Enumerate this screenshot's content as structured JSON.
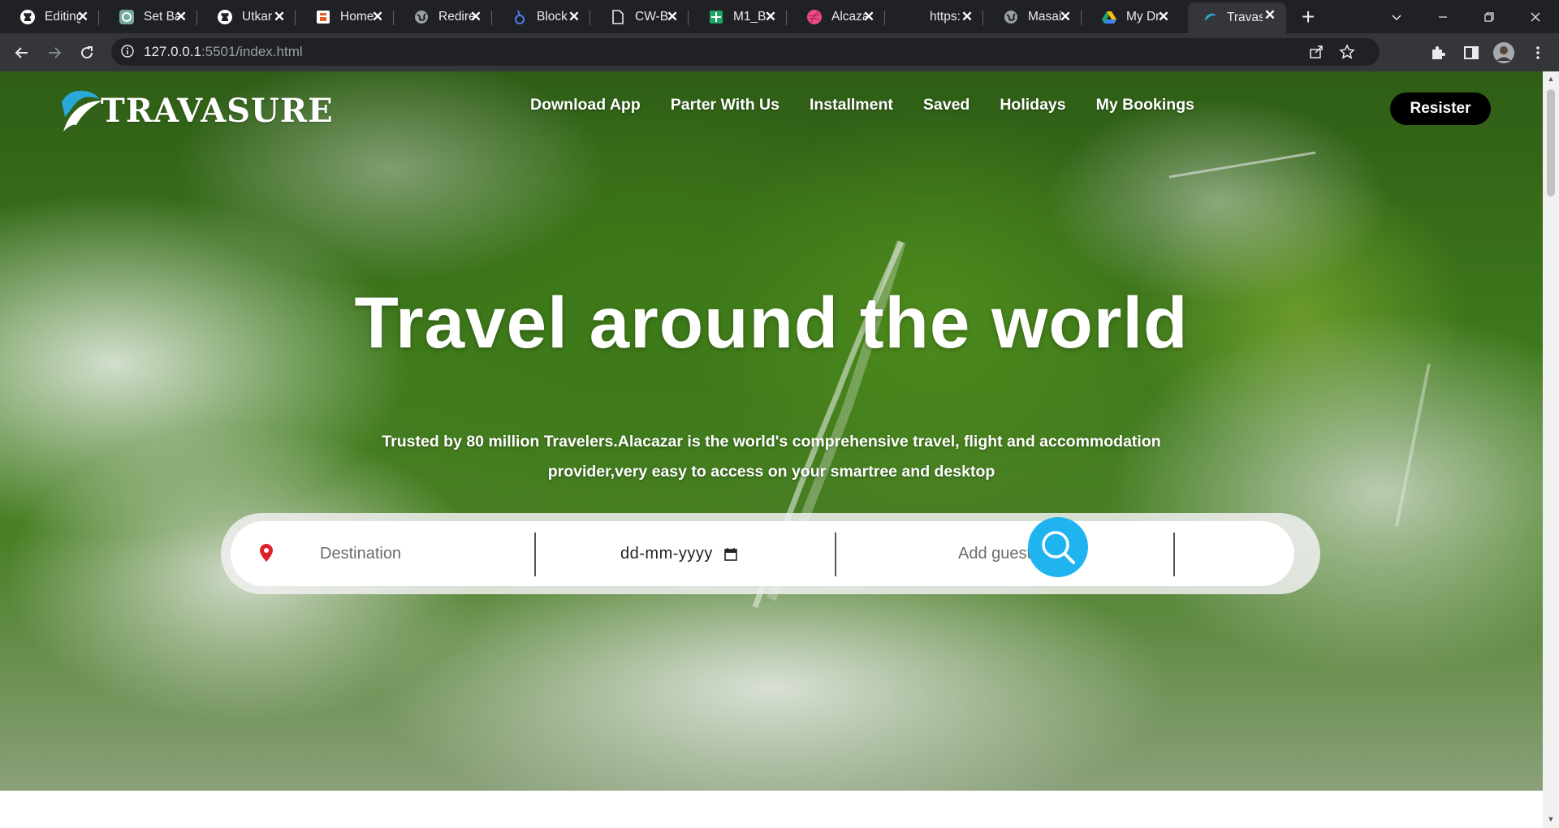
{
  "browser": {
    "tabs": [
      {
        "title": "Editing",
        "icon": "github-icon",
        "active": false
      },
      {
        "title": "Set Ba",
        "icon": "chatgpt-icon",
        "active": false
      },
      {
        "title": "Utkar",
        "icon": "github-icon",
        "active": false
      },
      {
        "title": "Home",
        "icon": "app-icon",
        "active": false
      },
      {
        "title": "Redire",
        "icon": "globe-icon",
        "active": false
      },
      {
        "title": "Block",
        "icon": "lens-icon",
        "active": false
      },
      {
        "title": "CW-B",
        "icon": "doc-icon",
        "active": false
      },
      {
        "title": "M1_B",
        "icon": "sheets-icon",
        "active": false
      },
      {
        "title": "Alcaza",
        "icon": "dribbble-icon",
        "active": false
      },
      {
        "title": "https:",
        "icon": "",
        "active": false
      },
      {
        "title": "Masai",
        "icon": "globe-icon",
        "active": false
      },
      {
        "title": "My Dr",
        "icon": "drive-icon",
        "active": false
      },
      {
        "title": "Travas",
        "icon": "travasure-icon",
        "active": true
      }
    ],
    "url_host": "127.0.0.1",
    "url_rest": ":5501/index.html"
  },
  "site": {
    "brand": "TRAVASURE",
    "nav": [
      "Download App",
      "Parter With Us",
      "Installment",
      "Saved",
      "Holidays",
      "My Bookings"
    ],
    "register_label": "Resister",
    "headline": "Travel around the world",
    "subtitle": "Trusted by 80 million Travelers.Alacazar is the world's comprehensive travel, flight and accommodation provider,very easy to access on your smartree and desktop",
    "search": {
      "destination_placeholder": "Destination",
      "date_placeholder": "dd-mm-yyyy",
      "guest_placeholder": "Add guest"
    }
  },
  "colors": {
    "accent": "#1fb4f0",
    "pin": "#e0202a",
    "register_bg": "#000000"
  }
}
